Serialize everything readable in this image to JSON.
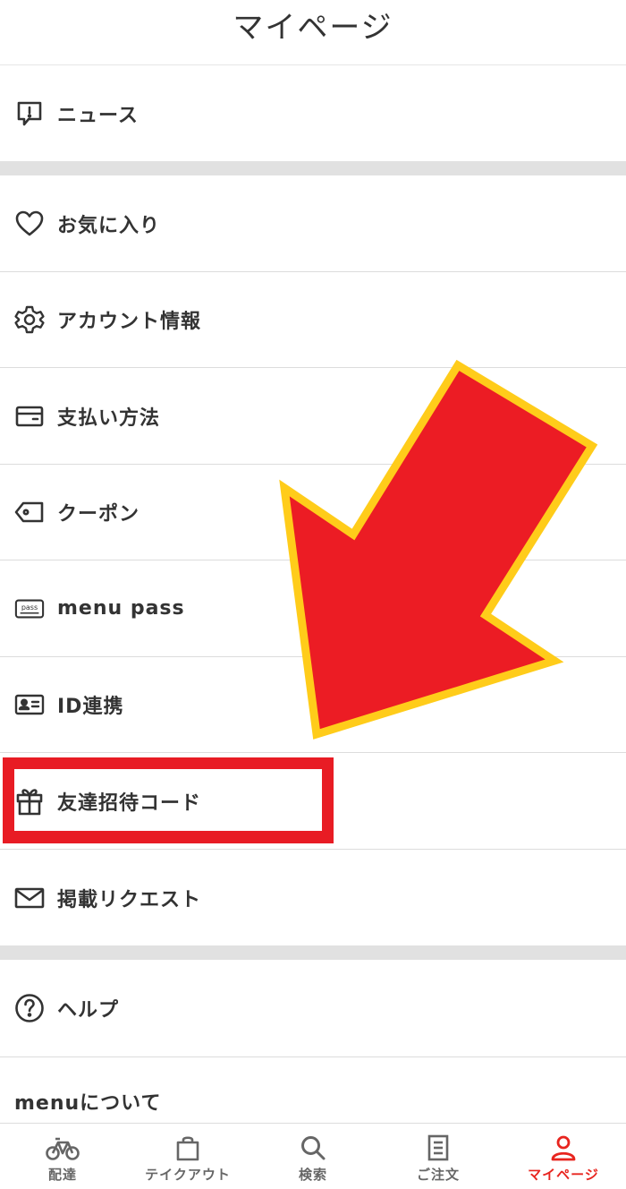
{
  "header": {
    "title": "マイページ"
  },
  "menu": {
    "news": "ニュース",
    "favorites": "お気に入り",
    "account": "アカウント情報",
    "payment": "支払い方法",
    "coupon": "クーポン",
    "menu_pass": "menu pass",
    "id_link": "ID連携",
    "invite_code": "友達招待コード",
    "listing_request": "掲載リクエスト",
    "help": "ヘルプ",
    "about": "menuについて"
  },
  "tabs": {
    "delivery": "配達",
    "takeout": "テイクアウト",
    "search": "検索",
    "orders": "ご注文",
    "mypage": "マイページ"
  },
  "colors": {
    "accent": "#e8251f",
    "highlight": "#e81c24",
    "arrow_fill": "#ec1c24",
    "arrow_stroke": "#ffcc1a"
  }
}
